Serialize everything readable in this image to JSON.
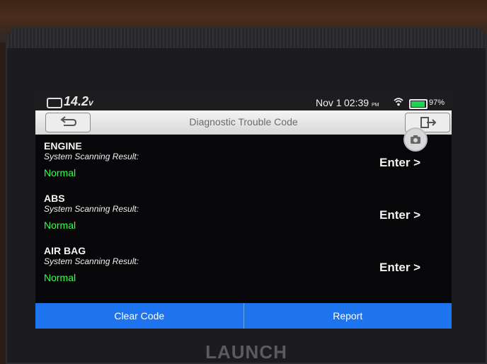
{
  "status": {
    "voltage": "14.2",
    "voltage_unit": "v",
    "date": "Nov 1",
    "time": "02:39",
    "time_suffix": "PM",
    "battery_pct": "97%",
    "battery_level": 0.97
  },
  "header": {
    "title": "Diagnostic Trouble Code"
  },
  "systems": [
    {
      "name": "ENGINE",
      "result_label": "System Scanning Result:",
      "result": "Normal",
      "action": "Enter >"
    },
    {
      "name": "ABS",
      "result_label": "System Scanning Result:",
      "result": "Normal",
      "action": "Enter >"
    },
    {
      "name": "AIR BAG",
      "result_label": "System Scanning Result:",
      "result": "Normal",
      "action": "Enter >"
    }
  ],
  "footer": {
    "clear_code": "Clear Code",
    "report": "Report"
  },
  "device": {
    "brand": "LAUNCH"
  },
  "colors": {
    "accent": "#1e74ee",
    "normal": "#37ff4a",
    "battery": "#1fd255"
  },
  "icons": {
    "back": "back-arrow-icon",
    "exit": "exit-icon",
    "screenshot": "camera-icon",
    "wifi": "wifi-icon",
    "battery": "battery-icon",
    "car": "car-battery-icon"
  }
}
